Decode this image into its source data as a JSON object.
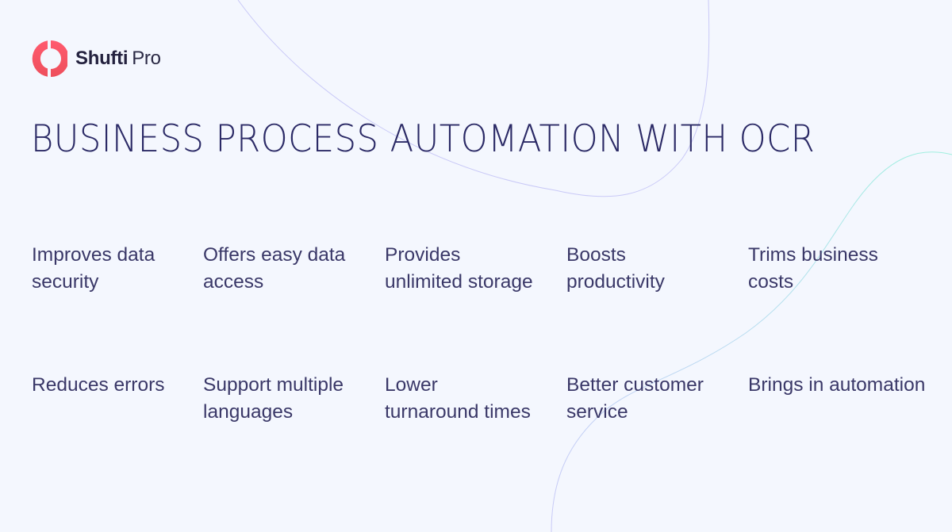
{
  "brand": {
    "name_bold": "Shufti",
    "name_light": "Pro",
    "icon": "shufti-pro-logo-icon",
    "colors": {
      "logo_gradient_start": "#ff5a6e",
      "logo_gradient_end": "#f2525f",
      "text_dark": "#24223f"
    }
  },
  "title": "BUSINESS PROCESS AUTOMATION WITH OCR",
  "colors": {
    "background": "#f4f7fe",
    "title": "#2b2a66",
    "feature_text": "#3a3868",
    "curve_lavender": "#c9c9f7",
    "curve_teal": "#9ff0df"
  },
  "features": {
    "row1": [
      {
        "line1": "Improves data",
        "line2": "security"
      },
      {
        "line1": "Offers easy data",
        "line2": "access"
      },
      {
        "line1": "Provides",
        "line2": "unlimited storage"
      },
      {
        "line1": "Boosts",
        "line2": "productivity"
      },
      {
        "line1": "Trims business",
        "line2": "costs"
      }
    ],
    "row2": [
      {
        "line1": "Reduces errors",
        "line2": ""
      },
      {
        "line1": "Support multiple",
        "line2": "languages"
      },
      {
        "line1": "Lower",
        "line2": "turnaround times"
      },
      {
        "line1": "Better customer",
        "line2": "service"
      },
      {
        "line1": "Brings in automation",
        "line2": ""
      }
    ]
  }
}
